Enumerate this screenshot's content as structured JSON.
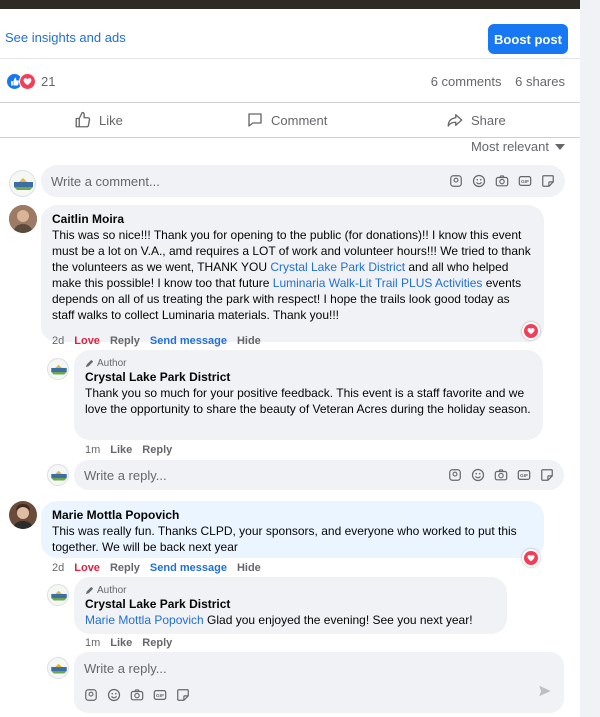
{
  "post": {
    "insights_link": "See insights and ads",
    "boost_button": "Boost post",
    "reaction_count": "21",
    "comments_count": "6 comments",
    "shares_count": "6 shares",
    "actions": {
      "like": "Like",
      "comment": "Comment",
      "share": "Share"
    },
    "sort_label": "Most relevant"
  },
  "composer": {
    "placeholder": "Write a comment..."
  },
  "reply_placeholder": "Write a reply...",
  "comments": [
    {
      "author": "Caitlin Moira",
      "text_1": "This was so nice!!! Thank you for opening to the public (for donations)!! I know this event must be a lot on V.A., amd requires a LOT of work and volunteer hours!!! We tried to thank the volunteers as we went, THANK YOU ",
      "link_1": "Crystal Lake Park District",
      "text_2": " and all who helped make this possible! I know too that future ",
      "link_2": "Luminaria Walk-Lit Trail PLUS Activities",
      "text_3": " events depends on all of us treating the park with respect! I hope the trails look good today as staff walks to collect Luminaria materials. Thank you!!!",
      "time": "2d",
      "love": "Love",
      "reply": "Reply",
      "send_message": "Send message",
      "hide": "Hide",
      "reply_item": {
        "badge": "Author",
        "author": "Crystal Lake Park District",
        "text": "Thank you so much for your positive feedback. This event is a staff favorite and we love the opportunity to share the beauty of Veteran Acres during the holiday season.",
        "time": "1m",
        "like": "Like",
        "reply": "Reply"
      }
    },
    {
      "author": "Marie Mottla Popovich",
      "text": "This was really fun. Thanks CLPD, your sponsors, and everyone who worked to put this together. We will be back next year",
      "time": "2d",
      "love": "Love",
      "reply": "Reply",
      "send_message": "Send message",
      "hide": "Hide",
      "reply_item": {
        "badge": "Author",
        "author": "Crystal Lake Park District",
        "mention": "Marie Mottla Popovich",
        "text": " Glad you enjoyed the evening! See you next year!",
        "time": "1m",
        "like": "Like",
        "reply": "Reply"
      }
    }
  ],
  "colors": {
    "accent": "#1877f2",
    "link": "#216fdb",
    "love": "#f33e58",
    "muted": "#65676b"
  }
}
